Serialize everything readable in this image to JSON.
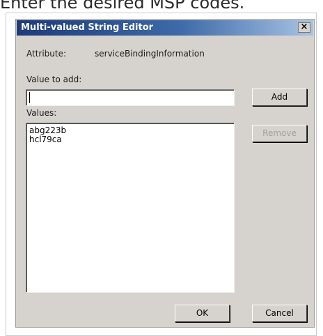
{
  "caption": "Enter the desired MSP codes.",
  "dialog": {
    "title": "Multi-valued String Editor",
    "close_symbol": "×",
    "attribute_label": "Attribute:",
    "attribute_value": "serviceBindingInformation",
    "value_to_add_label": "Value to add:",
    "value_to_add": "",
    "add_button": "Add",
    "values_label": "Values:",
    "values": [
      "abg223b",
      "hcl79ca"
    ],
    "remove_button": "Remove",
    "ok_button": "OK",
    "cancel_button": "Cancel"
  }
}
